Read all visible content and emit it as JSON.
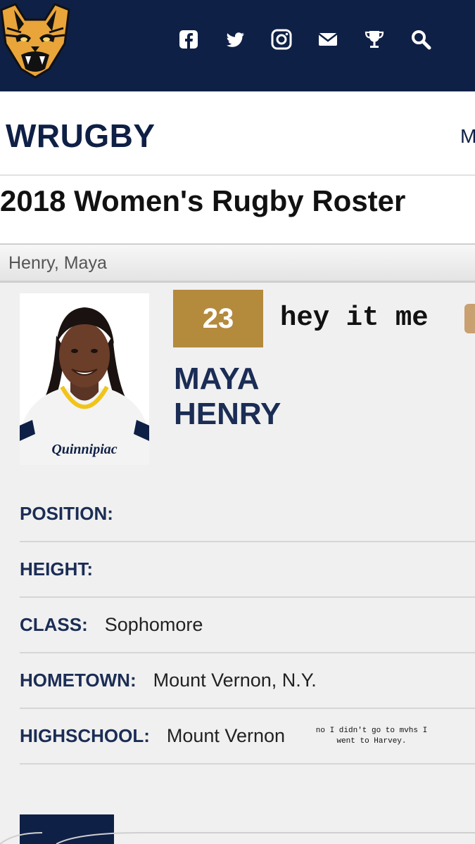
{
  "nav": {
    "icons": [
      "facebook-icon",
      "twitter-icon",
      "instagram-icon",
      "mail-icon",
      "trophy-icon",
      "search-icon"
    ]
  },
  "section": {
    "title": "WRUGBY",
    "more": "M"
  },
  "page": {
    "title": "2018 Women's Rugby Roster"
  },
  "breadcrumb": "Henry, Maya",
  "player": {
    "number": "23",
    "first_name": "MAYA",
    "last_name": "HENRY",
    "photo_text": "Quinnipiac"
  },
  "overlay": {
    "caption": "hey it me",
    "note_line1": "no I didn't go to mvhs I",
    "note_line2": "went to Harvey."
  },
  "info": {
    "position_label": "POSITION:",
    "position_value": "",
    "height_label": "HEIGHT:",
    "height_value": "",
    "class_label": "CLASS:",
    "class_value": "Sophomore",
    "hometown_label": "HOMETOWN:",
    "hometown_value": "Mount Vernon, N.Y.",
    "highschool_label": "HIGHSCHOOL:",
    "highschool_value": "Mount Vernon"
  },
  "colors": {
    "navy": "#0f2046",
    "gold": "#b48a3d"
  }
}
